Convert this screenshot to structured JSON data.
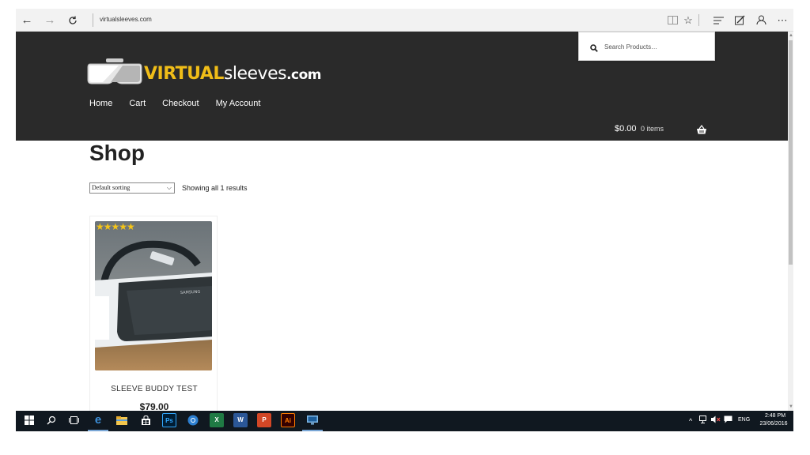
{
  "browser": {
    "url": "virtualsleeves.com",
    "icons": [
      "back-arrow-icon",
      "forward-arrow-icon",
      "refresh-icon",
      "reading-view-icon",
      "favorite-star-icon",
      "hub-icon",
      "web-note-icon",
      "share-icon",
      "more-icon"
    ]
  },
  "site": {
    "logo": {
      "virtual": "VIRTUAL",
      "sleeves": "sleeves",
      "com": ".com"
    },
    "nav": [
      {
        "label": "Home"
      },
      {
        "label": "Cart"
      },
      {
        "label": "Checkout"
      },
      {
        "label": "My Account"
      }
    ],
    "cart": {
      "total": "$0.00",
      "items": "0 items"
    },
    "search": {
      "placeholder": "Search Products…"
    },
    "colors": {
      "header_bg": "#2a2a2a",
      "logo_accent": "#f0bd18",
      "star": "#f5c518"
    }
  },
  "shop": {
    "title": "Shop",
    "sorting": "Default sorting",
    "result_count": "Showing all 1 results",
    "products": [
      {
        "title": "SLEEVE BUDDY TEST",
        "price": "$79.00",
        "rating": 5,
        "rating_stars": "★★★★★",
        "image_label": "SAMSUNG"
      }
    ]
  },
  "taskbar": {
    "apps": [
      "start-icon",
      "search-icon",
      "task-view-icon",
      "edge-icon",
      "file-explorer-icon",
      "store-icon",
      "photoshop-icon",
      "chrome-icon",
      "excel-icon",
      "word-icon",
      "powerpoint-icon",
      "illustrator-icon",
      "remote-desktop-icon"
    ],
    "labels": {
      "ps": "Ps",
      "excel": "X",
      "word": "W",
      "ppt": "P",
      "ai": "Ai"
    },
    "language": "ENG",
    "time": "2:48 PM",
    "date": "23/06/2016"
  }
}
